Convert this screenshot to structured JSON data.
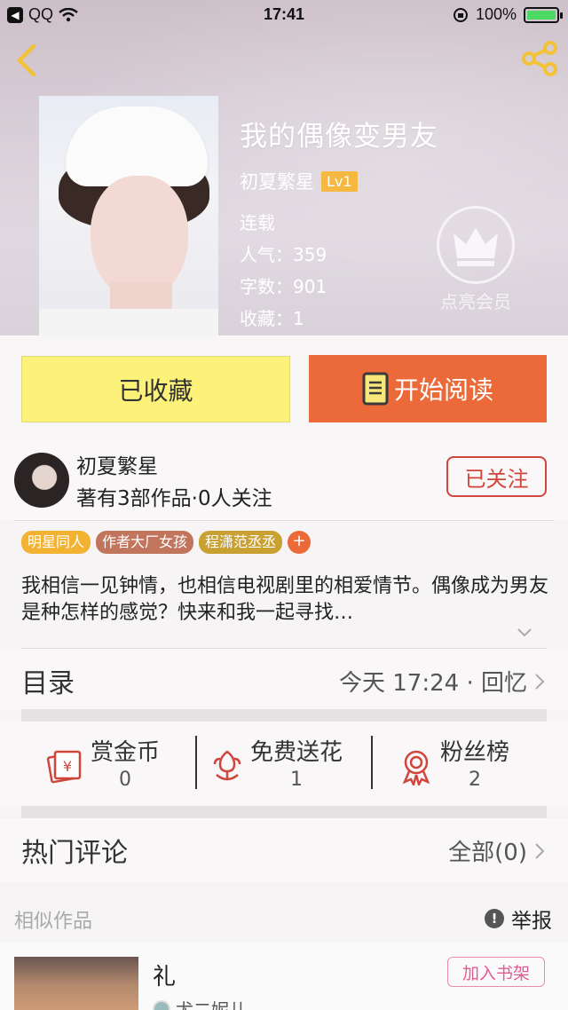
{
  "status_bar": {
    "app": "QQ",
    "time": "17:41",
    "battery": "100%",
    "battery_level": 1.0
  },
  "book": {
    "title": "我的偶像变男友",
    "author": "初夏繁星",
    "author_level": "Lv1",
    "status": "连载",
    "popularity": "人气：359",
    "word_count": "字数：901",
    "favorites": "收藏：1"
  },
  "vip": {
    "label": "点亮会员"
  },
  "actions": {
    "favorite_label": "已收藏",
    "read_label": "开始阅读"
  },
  "author_card": {
    "name": "初夏繁星",
    "stats": "著有3部作品·0人关注",
    "follow_label": "已关注"
  },
  "tags": [
    {
      "label": "明星同人",
      "color": "#f2b232"
    },
    {
      "label": "作者大厂女孩",
      "color": "#c2755d"
    },
    {
      "label": "程潇范丞丞",
      "color": "#c9a132"
    }
  ],
  "tag_add": "+",
  "description": "我相信一见钟情，也相信电视剧里的相爱情节。偶像成为男友是种怎样的感觉？快来和我一起寻找…",
  "catalog": {
    "title": "目录",
    "latest": "今天 17:24 · 回忆"
  },
  "gifts": [
    {
      "label": "赏金币",
      "count": "0",
      "icon": "coin-envelope-icon"
    },
    {
      "label": "免费送花",
      "count": "1",
      "icon": "flower-icon"
    },
    {
      "label": "粉丝榜",
      "count": "2",
      "icon": "medal-icon"
    }
  ],
  "comments": {
    "title": "热门评论",
    "all_label": "全部(0)"
  },
  "similar": {
    "title": "相似作品",
    "report_label": "举报",
    "items": [
      {
        "title": "礼",
        "author": "尤二妮儿",
        "add_label": "加入书架"
      }
    ]
  },
  "colors": {
    "accent_orange": "#ec6a3a",
    "fav_yellow": "#fcf27a",
    "follow_red": "#d0453c",
    "vip_gold": "#f5b942"
  }
}
